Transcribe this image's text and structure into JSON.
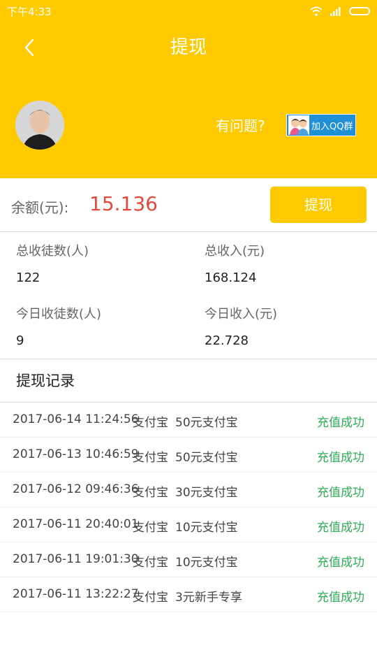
{
  "status_bar": {
    "time": "下午4:33"
  },
  "header": {
    "title": "提现",
    "back_icon": "chevron-left-icon",
    "question": "有问题?",
    "qq_button_label": "加入QQ群"
  },
  "balance": {
    "label": "余额(元):",
    "value": "15.136",
    "withdraw_label": "提现"
  },
  "stats": {
    "total_apprentices_label": "总收徒数(人)",
    "total_apprentices_value": "122",
    "total_income_label": "总收入(元)",
    "total_income_value": "168.124",
    "today_apprentices_label": "今日收徒数(人)",
    "today_apprentices_value": "9",
    "today_income_label": "今日收入(元)",
    "today_income_value": "22.728"
  },
  "records": {
    "title": "提现记录",
    "items": [
      {
        "time": "2017-06-14 11:24:56",
        "method": "支付宝",
        "desc": "50元支付宝",
        "status": "充值成功"
      },
      {
        "time": "2017-06-13 10:46:59",
        "method": "支付宝",
        "desc": "50元支付宝",
        "status": "充值成功"
      },
      {
        "time": "2017-06-12 09:46:36",
        "method": "支付宝",
        "desc": "30元支付宝",
        "status": "充值成功"
      },
      {
        "time": "2017-06-11 20:40:01",
        "method": "支付宝",
        "desc": "10元支付宝",
        "status": "充值成功"
      },
      {
        "time": "2017-06-11 19:01:30",
        "method": "支付宝",
        "desc": "10元支付宝",
        "status": "充值成功"
      },
      {
        "time": "2017-06-11 13:22:27",
        "method": "支付宝",
        "desc": "3元新手专享",
        "status": "充值成功"
      }
    ]
  },
  "colors": {
    "brand_yellow": "#ffca00",
    "balance_red": "#e34a3c",
    "success_green": "#2eae55",
    "qq_blue": "#1f8fd6"
  }
}
